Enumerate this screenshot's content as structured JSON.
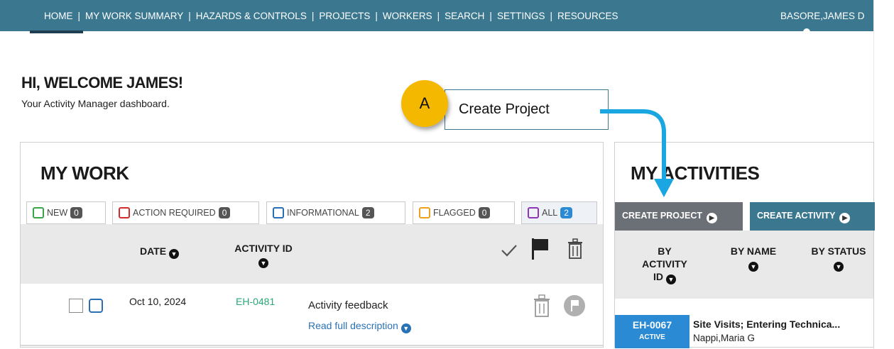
{
  "nav": {
    "items": [
      "HOME",
      "MY WORK SUMMARY",
      "HAZARDS & CONTROLS",
      "PROJECTS",
      "WORKERS",
      "SEARCH",
      "SETTINGS",
      "RESOURCES"
    ],
    "user": "BASORE,JAMES D"
  },
  "welcome": {
    "title": "HI, WELCOME JAMES!",
    "subtitle": "Your Activity Manager dashboard."
  },
  "callout": {
    "badge": "A",
    "text": "Create Project"
  },
  "my_work": {
    "title": "MY WORK",
    "tabs": [
      {
        "label": "NEW",
        "count": "0",
        "color": "#3aa64a"
      },
      {
        "label": "ACTION REQUIRED",
        "count": "0",
        "color": "#d62b2b"
      },
      {
        "label": "INFORMATIONAL",
        "count": "2",
        "color": "#2a6fb6"
      },
      {
        "label": "FLAGGED",
        "count": "0",
        "color": "#f0a020"
      },
      {
        "label": "ALL",
        "count": "2",
        "color": "#8e35b8"
      }
    ],
    "columns": {
      "date": "DATE",
      "activity_id": "ACTIVITY ID"
    },
    "row": {
      "date": "Oct 10, 2024",
      "activity_id": "EH-0481",
      "title": "Activity feedback",
      "link": "Read full description"
    }
  },
  "my_activities": {
    "title": "MY ACTIVITIES",
    "buttons": {
      "create_project": "CREATE PROJECT",
      "create_activity": "CREATE ACTIVITY"
    },
    "columns": {
      "by_id_line1": "BY",
      "by_id_line2": "ACTIVITY",
      "by_id_line3": "ID",
      "by_name": "BY NAME",
      "by_status": "BY STATUS"
    },
    "row": {
      "id": "EH-0067",
      "status": "ACTIVE",
      "name": "Site Visits; Entering Technica...",
      "owner": "Nappi,Maria G"
    }
  },
  "colors": {
    "topbar": "#3b7890",
    "accent_blue": "#2a8ad4",
    "callout_badge": "#f5b800",
    "id_green": "#2aa876"
  }
}
